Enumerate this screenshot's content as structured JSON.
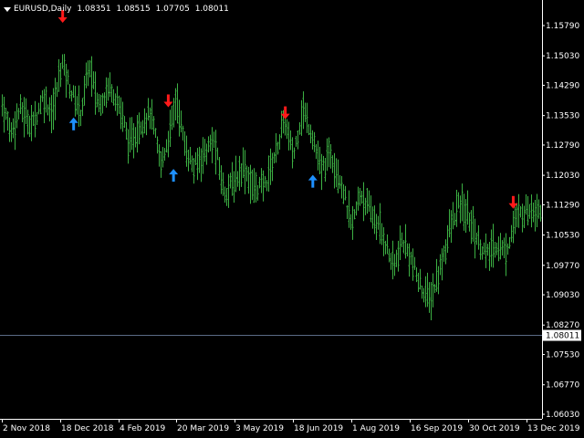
{
  "header": {
    "symbol_timeframe": "EURUSD,Daily",
    "open": "1.08351",
    "high": "1.08515",
    "low": "1.07705",
    "close": "1.08011"
  },
  "theme": {
    "background": "#000000",
    "bar_color": "#3cb043",
    "axis_color": "#ffffff",
    "text_color": "#ffffff",
    "price_line_color": "#5b6b86",
    "price_label_bg": "#ffffff",
    "price_label_text": "#000000",
    "arrow_down_color": "#ff1a1a",
    "arrow_up_color": "#1e90ff",
    "arrow_down_icon": "arrow-down-icon",
    "arrow_up_icon": "arrow-up-icon"
  },
  "price_axis": {
    "ticks": [
      "1.15790",
      "1.15030",
      "1.14290",
      "1.13530",
      "1.12790",
      "1.12030",
      "1.11290",
      "1.10530",
      "1.09770",
      "1.09030",
      "1.08270",
      "1.07530",
      "1.06770",
      "1.06030"
    ],
    "current_price_label": "1.08011"
  },
  "time_axis": {
    "labels": [
      "2 Nov 2018",
      "18 Dec 2018",
      "4 Feb 2019",
      "20 Mar 2019",
      "3 May 2019",
      "18 Jun 2019",
      "1 Aug 2019",
      "16 Sep 2019",
      "30 Oct 2019",
      "13 Dec 2019"
    ]
  },
  "chart_data": {
    "type": "ohlc",
    "symbol": "EURUSD",
    "timeframe": "Daily",
    "ylim": [
      1.0603,
      1.1579
    ],
    "x_range": [
      "2 Nov 2018",
      "13 Dec 2019"
    ],
    "current_price": 1.08011,
    "price_path": [
      {
        "date": "2 Nov 2018",
        "price": 1.138
      },
      {
        "date": "9 Nov 2018",
        "price": 1.131
      },
      {
        "date": "16 Nov 2018",
        "price": 1.137
      },
      {
        "date": "26 Nov 2018",
        "price": 1.133
      },
      {
        "date": "4 Dec 2018",
        "price": 1.14
      },
      {
        "date": "12 Dec 2018",
        "price": 1.136
      },
      {
        "date": "19 Dec 2018",
        "price": 1.149
      },
      {
        "date": "27 Dec 2018",
        "price": 1.141
      },
      {
        "date": "4 Jan 2019",
        "price": 1.136
      },
      {
        "date": "10 Jan 2019",
        "price": 1.148
      },
      {
        "date": "18 Jan 2019",
        "price": 1.138
      },
      {
        "date": "28 Jan 2019",
        "price": 1.143
      },
      {
        "date": "5 Feb 2019",
        "price": 1.137
      },
      {
        "date": "12 Feb 2019",
        "price": 1.128
      },
      {
        "date": "20 Feb 2019",
        "price": 1.133
      },
      {
        "date": "28 Feb 2019",
        "price": 1.136
      },
      {
        "date": "8 Mar 2019",
        "price": 1.123
      },
      {
        "date": "15 Mar 2019",
        "price": 1.131
      },
      {
        "date": "20 Mar 2019",
        "price": 1.14
      },
      {
        "date": "26 Mar 2019",
        "price": 1.128
      },
      {
        "date": "2 Apr 2019",
        "price": 1.122
      },
      {
        "date": "10 Apr 2019",
        "price": 1.126
      },
      {
        "date": "17 Apr 2019",
        "price": 1.129
      },
      {
        "date": "25 Apr 2019",
        "price": 1.116
      },
      {
        "date": "3 May 2019",
        "price": 1.119
      },
      {
        "date": "10 May 2019",
        "price": 1.123
      },
      {
        "date": "17 May 2019",
        "price": 1.117
      },
      {
        "date": "27 May 2019",
        "price": 1.118
      },
      {
        "date": "4 Jun 2019",
        "price": 1.126
      },
      {
        "date": "11 Jun 2019",
        "price": 1.134
      },
      {
        "date": "18 Jun 2019",
        "price": 1.125
      },
      {
        "date": "25 Jun 2019",
        "price": 1.137
      },
      {
        "date": "2 Jul 2019",
        "price": 1.131
      },
      {
        "date": "9 Jul 2019",
        "price": 1.121
      },
      {
        "date": "16 Jul 2019",
        "price": 1.126
      },
      {
        "date": "24 Jul 2019",
        "price": 1.119
      },
      {
        "date": "1 Aug 2019",
        "price": 1.107
      },
      {
        "date": "8 Aug 2019",
        "price": 1.116
      },
      {
        "date": "16 Aug 2019",
        "price": 1.111
      },
      {
        "date": "26 Aug 2019",
        "price": 1.105
      },
      {
        "date": "3 Sep 2019",
        "price": 1.097
      },
      {
        "date": "10 Sep 2019",
        "price": 1.104
      },
      {
        "date": "16 Sep 2019",
        "price": 1.1
      },
      {
        "date": "23 Sep 2019",
        "price": 1.093
      },
      {
        "date": "1 Oct 2019",
        "price": 1.089
      },
      {
        "date": "8 Oct 2019",
        "price": 1.096
      },
      {
        "date": "16 Oct 2019",
        "price": 1.107
      },
      {
        "date": "23 Oct 2019",
        "price": 1.113
      },
      {
        "date": "30 Oct 2019",
        "price": 1.11
      },
      {
        "date": "6 Nov 2019",
        "price": 1.104
      },
      {
        "date": "13 Nov 2019",
        "price": 1.1
      },
      {
        "date": "20 Nov 2019",
        "price": 1.103
      },
      {
        "date": "27 Nov 2019",
        "price": 1.101
      },
      {
        "date": "4 Dec 2019",
        "price": 1.109
      },
      {
        "date": "13 Dec 2019",
        "price": 1.112
      }
    ],
    "signals": [
      {
        "type": "sell",
        "date": "20 Dec 2018",
        "price": 1.1602
      },
      {
        "type": "buy",
        "date": "29 Dec 2018",
        "price": 1.1332
      },
      {
        "type": "sell",
        "date": "14 Mar 2019",
        "price": 1.139
      },
      {
        "type": "buy",
        "date": "18 Mar 2019",
        "price": 1.1203
      },
      {
        "type": "sell",
        "date": "12 Jun 2019",
        "price": 1.136
      },
      {
        "type": "buy",
        "date": "3 Jul 2019",
        "price": 1.1188
      },
      {
        "type": "sell",
        "date": "3 Dec 2019",
        "price": 1.1135
      }
    ]
  }
}
